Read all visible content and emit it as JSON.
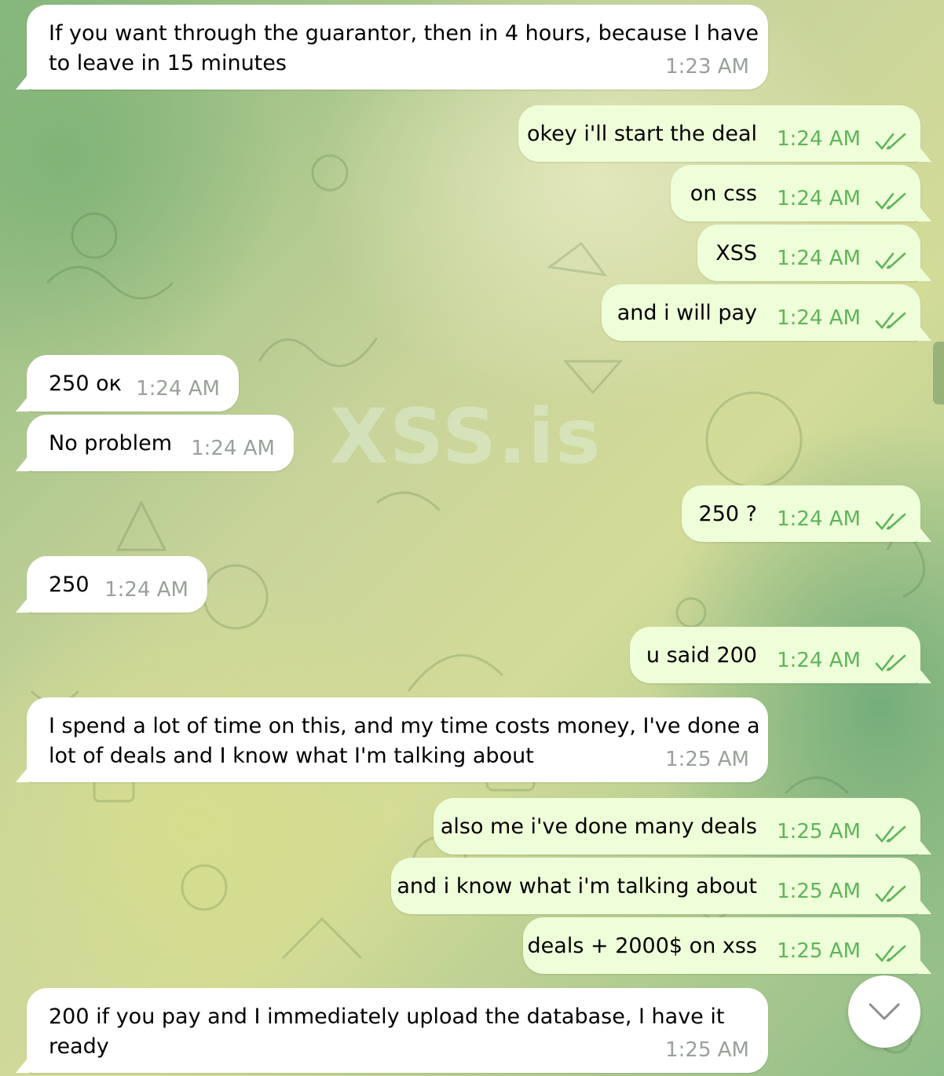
{
  "watermark": "XSS.is",
  "messages": [
    {
      "dir": "in",
      "lines": [
        "If you want through the guarantor, then in 4 hours, because I have",
        "to leave in 15 minutes"
      ],
      "time": "1:23 AM"
    },
    {
      "dir": "out",
      "text": "okey i'll start the deal",
      "time": "1:24 AM"
    },
    {
      "dir": "out",
      "text": "on css",
      "time": "1:24 AM"
    },
    {
      "dir": "out",
      "text": "XSS",
      "time": "1:24 AM"
    },
    {
      "dir": "out",
      "text": "and i will pay",
      "time": "1:24 AM"
    },
    {
      "dir": "in",
      "text": "250 ок",
      "time": "1:24 AM"
    },
    {
      "dir": "in",
      "text": "No problem",
      "time": "1:24 AM"
    },
    {
      "dir": "out",
      "text": "250 ?",
      "time": "1:24 AM"
    },
    {
      "dir": "in",
      "text": "250",
      "time": "1:24 AM"
    },
    {
      "dir": "out",
      "text": "u said 200",
      "time": "1:24 AM"
    },
    {
      "dir": "in",
      "lines": [
        "I spend a lot of time on this, and my time costs money, I've done a",
        "lot of deals and I know what I'm talking about"
      ],
      "time": "1:25 AM"
    },
    {
      "dir": "out",
      "text": "also me i've done many deals",
      "time": "1:25 AM"
    },
    {
      "dir": "out",
      "text": "and i know what i'm talking about",
      "time": "1:25 AM"
    },
    {
      "dir": "out",
      "text": "deals + 2000$ on xss",
      "time": "1:25 AM"
    },
    {
      "dir": "in",
      "lines": [
        "200 if you pay and I immediately upload the database, I have it",
        "ready"
      ],
      "time": "1:25 AM"
    }
  ],
  "icons": {
    "read_receipt": "double-check-icon",
    "scroll_down": "chevron-down-icon"
  },
  "colors": {
    "incoming_bubble": "#ffffff",
    "outgoing_bubble": "#eefed9",
    "outgoing_time": "#5fb45a",
    "incoming_time": "#9aa09a"
  }
}
